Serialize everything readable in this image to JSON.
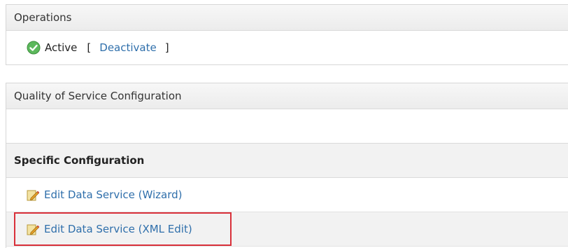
{
  "operations": {
    "header": "Operations",
    "status_label": "Active",
    "bracket_open": "[",
    "bracket_close": "]",
    "deactivate_label": "Deactivate",
    "status_icon": "check-circle-icon"
  },
  "qos": {
    "header": "Quality of Service Configuration",
    "section_title": "Specific Configuration",
    "links": [
      {
        "label": "Edit Data Service (Wizard)",
        "icon": "edit-pencil-icon"
      },
      {
        "label": "Edit Data Service (XML Edit)",
        "icon": "edit-pencil-icon"
      }
    ]
  },
  "colors": {
    "link": "#2f6fab",
    "active_green": "#5cb85c",
    "highlight_red": "#d9303a"
  }
}
